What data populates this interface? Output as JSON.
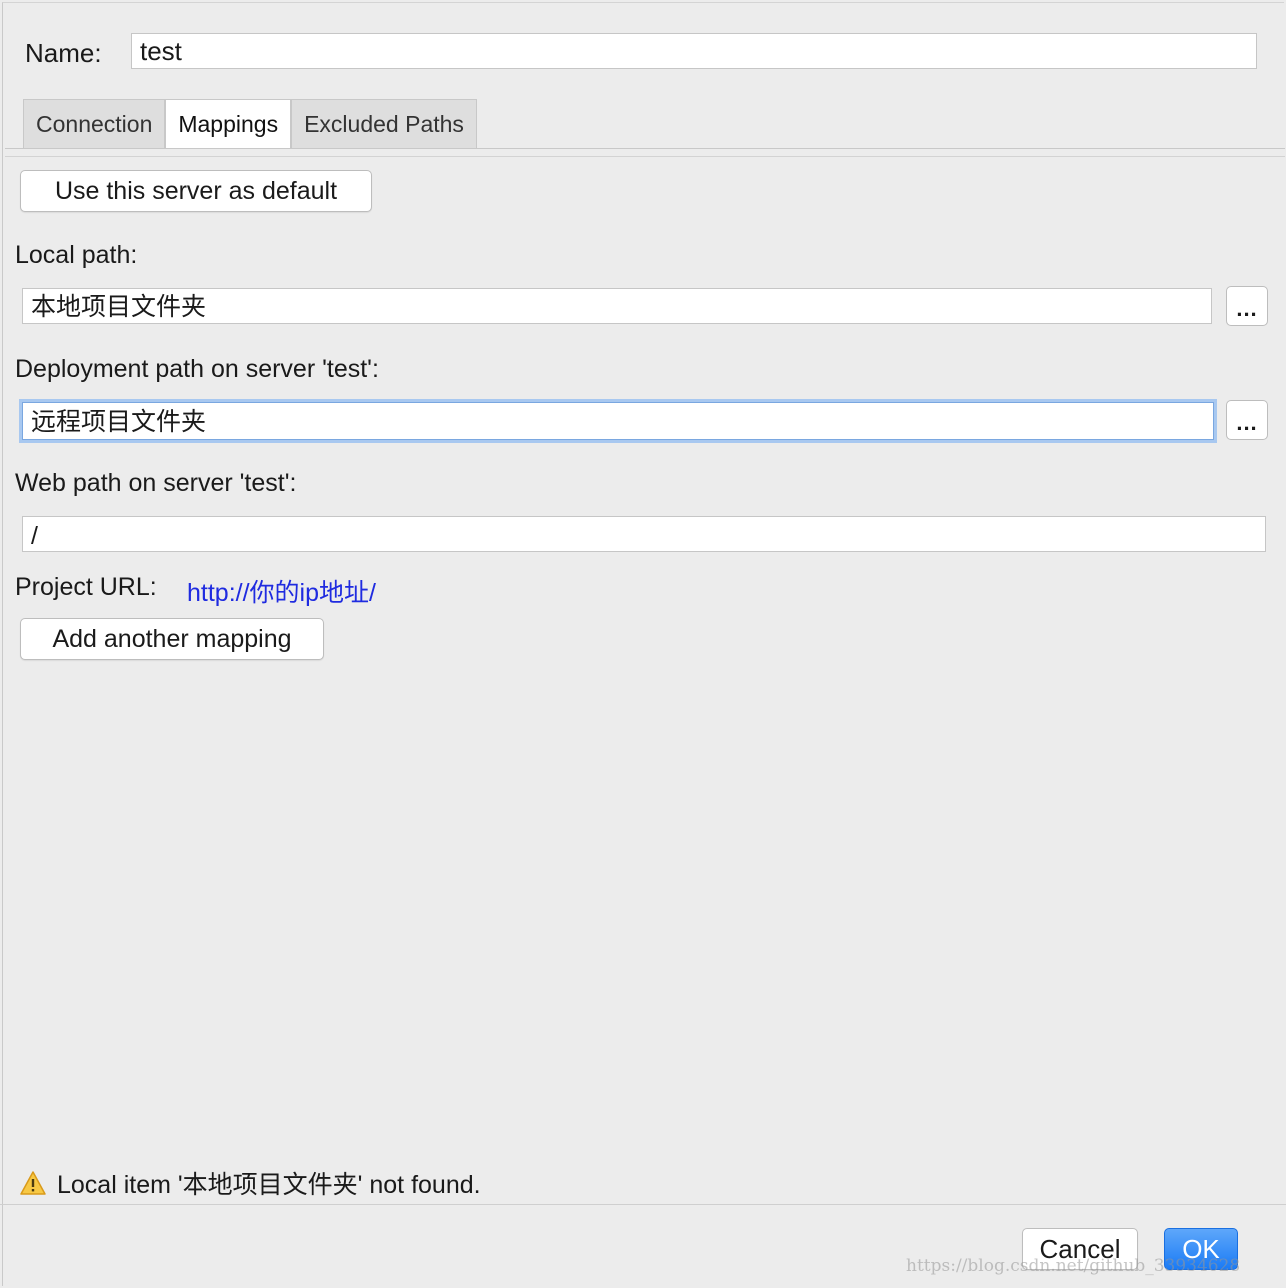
{
  "form": {
    "name_label": "Name:",
    "name_value": "test"
  },
  "tabs": [
    {
      "label": "Connection",
      "active": false
    },
    {
      "label": "Mappings",
      "active": true
    },
    {
      "label": "Excluded Paths",
      "active": false
    }
  ],
  "mappings": {
    "default_button": "Use this server as default",
    "local_path_label": "Local path:",
    "local_path_value": "本地项目文件夹",
    "browse_label": "...",
    "deployment_path_label": "Deployment path on server 'test':",
    "deployment_path_value": "远程项目文件夹",
    "web_path_label": "Web path on server 'test':",
    "web_path_value": "/",
    "project_url_label": "Project URL:",
    "project_url_value": "http://你的ip地址/",
    "add_mapping_button": "Add another mapping"
  },
  "status": {
    "warning_text": "Local item '本地项目文件夹' not found.",
    "warning_icon": "warning-icon"
  },
  "footer": {
    "cancel_label": "Cancel",
    "ok_label": "OK"
  },
  "watermark": "https://blog.csdn.net/github_33934628",
  "colors": {
    "accent": "#1b7bf5",
    "link": "#1f2be0",
    "focus": "#a8c8f0"
  }
}
